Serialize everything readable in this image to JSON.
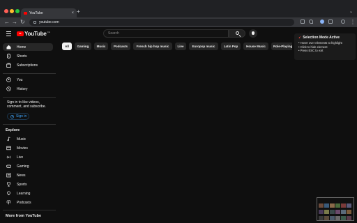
{
  "browser": {
    "tab_title": "YouTube",
    "tab_close": "×",
    "new_tab": "+",
    "url": "youtube.com",
    "back": "←",
    "forward": "→",
    "reload": "↻",
    "menu": "⋮",
    "chevron": "⌄",
    "traffic_colors": [
      "#ff5f57",
      "#febc2e",
      "#28c840"
    ]
  },
  "header": {
    "logo_text": "YouTube",
    "country_code": "DE",
    "search_placeholder": "Search"
  },
  "sidebar": {
    "primary": [
      {
        "label": "Home",
        "icon": "home-icon"
      },
      {
        "label": "Shorts",
        "icon": "shorts-icon"
      },
      {
        "label": "Subscriptions",
        "icon": "subscriptions-icon"
      }
    ],
    "secondary": [
      {
        "label": "You",
        "icon": "you-icon"
      },
      {
        "label": "History",
        "icon": "history-icon"
      }
    ],
    "signin_prompt": "Sign in to like videos, comment, and subscribe.",
    "signin_label": "Sign in",
    "explore_title": "Explore",
    "explore": [
      {
        "label": "Music",
        "icon": "music-icon"
      },
      {
        "label": "Movies",
        "icon": "movies-icon"
      },
      {
        "label": "Live",
        "icon": "live-icon"
      },
      {
        "label": "Gaming",
        "icon": "gaming-icon"
      },
      {
        "label": "News",
        "icon": "news-icon"
      },
      {
        "label": "Sports",
        "icon": "sports-icon"
      },
      {
        "label": "Learning",
        "icon": "learning-icon"
      },
      {
        "label": "Podcasts",
        "icon": "podcasts-icon"
      }
    ],
    "more_title": "More from YouTube"
  },
  "chips": [
    "All",
    "Gaming",
    "Music",
    "Podcasts",
    "French hip hop music",
    "Live",
    "Europop music",
    "Latin Pop",
    "House Music",
    "Role-Playing Games"
  ],
  "overlay": {
    "title": "Selection Mode Active",
    "lines": [
      "• Hover over elements to highlight",
      "• Click to hide element",
      "• Press ESC to exit"
    ]
  },
  "colors": {
    "background": "#0f0f0f",
    "brand_red": "#ff0000",
    "link_blue": "#3ea6ff",
    "chip_bg": "#272727"
  }
}
